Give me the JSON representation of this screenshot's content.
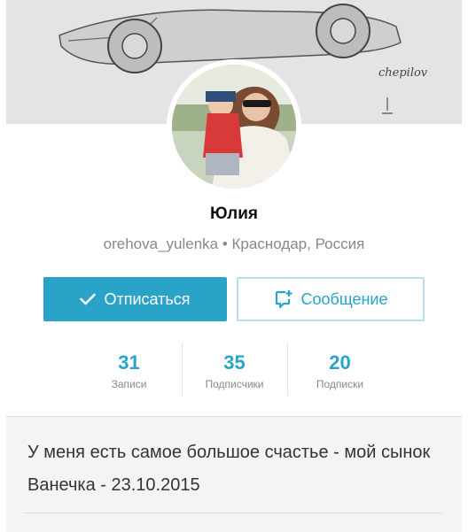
{
  "cover": {
    "signature": "chepilov"
  },
  "profile": {
    "name": "Юлия",
    "username": "orehova_yulenka",
    "separator": " • ",
    "location": "Краснодар, Россия"
  },
  "actions": {
    "unsubscribe_label": "Отписаться",
    "message_label": "Сообщение"
  },
  "stats": [
    {
      "value": "31",
      "label": "Записи"
    },
    {
      "value": "35",
      "label": "Подписчики"
    },
    {
      "value": "20",
      "label": "Подписки"
    }
  ],
  "about": {
    "text": "У меня есть самое большое счастье - мой сынок Ванечка - 23.10.2015"
  },
  "colors": {
    "accent": "#2aa3c9",
    "muted_text": "#888888"
  },
  "icons": {
    "unsubscribe": "checkmark-icon",
    "message": "message-add-icon"
  }
}
